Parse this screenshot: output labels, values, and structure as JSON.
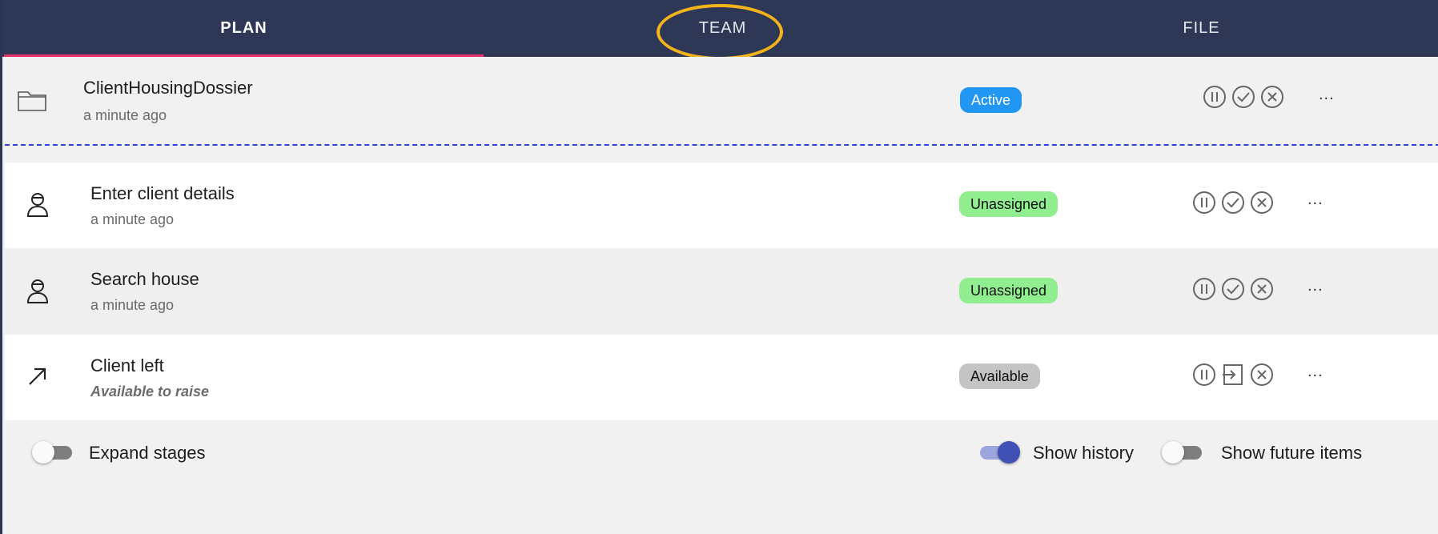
{
  "tabs": [
    {
      "label": "PLAN",
      "selected": true
    },
    {
      "label": "TEAM",
      "selected": false,
      "highlighted": true
    },
    {
      "label": "FILE",
      "selected": false
    }
  ],
  "colors": {
    "tabbar": "#2e3856",
    "tab_indicator": "#e5336a",
    "highlight_ring": "#f2b418",
    "active_badge": "#2196f3",
    "unassigned_badge": "#90ee90",
    "available_badge": "#c4c4c4",
    "toggle_on": "#3f51b5"
  },
  "case": {
    "icon": "folder-icon",
    "title": "ClientHousingDossier",
    "subtitle": "a minute ago",
    "status": "Active",
    "actions": [
      "pause-icon",
      "check-icon",
      "cancel-icon"
    ],
    "more": "..."
  },
  "items": [
    {
      "icon": "person-icon",
      "title": "Enter client details",
      "subtitle": "a minute ago",
      "status": "Unassigned",
      "actions": [
        "pause-icon",
        "check-icon",
        "cancel-icon"
      ],
      "more": "..."
    },
    {
      "icon": "person-icon",
      "title": "Search house",
      "subtitle": "a minute ago",
      "status": "Unassigned",
      "actions": [
        "pause-icon",
        "check-icon",
        "cancel-icon"
      ],
      "more": "..."
    },
    {
      "icon": "arrow-up-right-icon",
      "title": "Client left",
      "subtitle": "Available to raise",
      "status": "Available",
      "actions": [
        "pause-icon",
        "raise-icon",
        "cancel-icon"
      ],
      "more": "..."
    }
  ],
  "footer": {
    "expand_stages": {
      "label": "Expand stages",
      "on": false
    },
    "show_history": {
      "label": "Show history",
      "on": true
    },
    "show_future": {
      "label": "Show future items",
      "on": false
    }
  }
}
